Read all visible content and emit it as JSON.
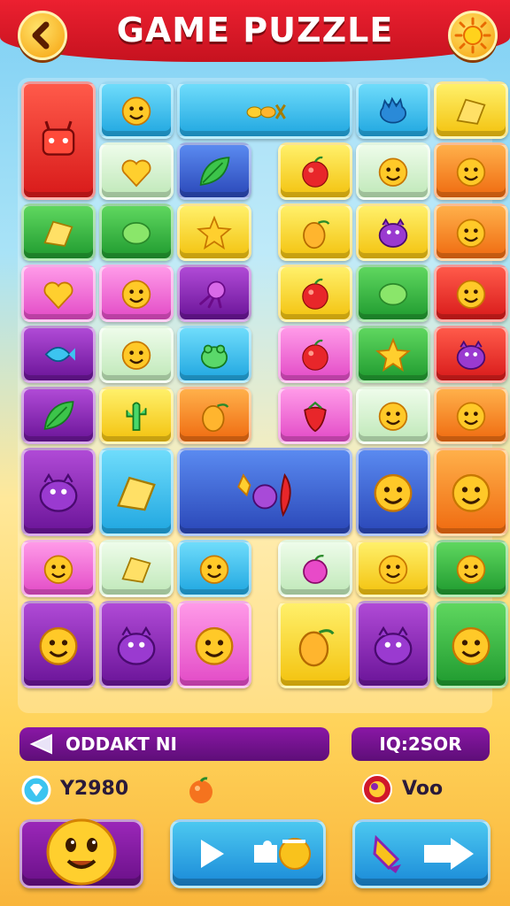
{
  "header": {
    "title": "GAME PUZZLE",
    "back_icon": "chevron-left-icon",
    "settings_icon": "sun-icon"
  },
  "colors": {
    "red": "#e8262a",
    "blue": "#3cc4f0",
    "green": "#2fb34a",
    "yellow": "#f9d51c",
    "orange": "#f5841e",
    "purple": "#8a22b0",
    "pink": "#f26ad6",
    "cream": "#d6f3d0",
    "navy": "#2a57c8"
  },
  "grid": {
    "tiles": [
      {
        "c": 0,
        "r": 0,
        "h": 2,
        "color": "red",
        "icon": "robot-icon"
      },
      {
        "c": 1,
        "r": 0,
        "color": "blue",
        "icon": "smiley-icon"
      },
      {
        "c": 2,
        "r": 0,
        "w": 2.3,
        "color": "blue",
        "icon": "food-icon"
      },
      {
        "c": 4.3,
        "r": 0,
        "color": "blue",
        "icon": "hedgehog-icon"
      },
      {
        "c": 5.3,
        "r": 0,
        "color": "yellow",
        "icon": "cheese-icon"
      },
      {
        "c": 1,
        "r": 1,
        "color": "cream",
        "icon": "heart-icon"
      },
      {
        "c": 2,
        "r": 1,
        "color": "navy",
        "icon": "leaf-icon"
      },
      {
        "c": 3.3,
        "r": 1,
        "color": "yellow",
        "icon": "apple-icon"
      },
      {
        "c": 4.3,
        "r": 1,
        "color": "cream",
        "icon": "smiley-icon"
      },
      {
        "c": 5.3,
        "r": 1,
        "color": "orange",
        "icon": "smiley-icon"
      },
      {
        "c": 0,
        "r": 2,
        "color": "green",
        "icon": "cheese-icon"
      },
      {
        "c": 1,
        "r": 2,
        "color": "green",
        "icon": "lemon-icon"
      },
      {
        "c": 2,
        "r": 2,
        "color": "yellow",
        "icon": "star-icon"
      },
      {
        "c": 3.3,
        "r": 2,
        "color": "yellow",
        "icon": "mango-icon"
      },
      {
        "c": 4.3,
        "r": 2,
        "color": "yellow",
        "icon": "monster-icon"
      },
      {
        "c": 5.3,
        "r": 2,
        "color": "orange",
        "icon": "smiley-icon"
      },
      {
        "c": 0,
        "r": 3,
        "color": "pink",
        "icon": "heart-icon"
      },
      {
        "c": 1,
        "r": 3,
        "color": "pink",
        "icon": "smiley-icon"
      },
      {
        "c": 2,
        "r": 3,
        "color": "purple",
        "icon": "octopus-icon"
      },
      {
        "c": 3.3,
        "r": 3,
        "color": "yellow",
        "icon": "apple-icon"
      },
      {
        "c": 4.3,
        "r": 3,
        "color": "green",
        "icon": "lemon-icon"
      },
      {
        "c": 5.3,
        "r": 3,
        "color": "red",
        "icon": "smiley-icon"
      },
      {
        "c": 0,
        "r": 4,
        "color": "purple",
        "icon": "fish-icon"
      },
      {
        "c": 1,
        "r": 4,
        "color": "cream",
        "icon": "smiley-icon"
      },
      {
        "c": 2,
        "r": 4,
        "color": "blue",
        "icon": "frog-icon"
      },
      {
        "c": 3.3,
        "r": 4,
        "color": "pink",
        "icon": "apple-icon"
      },
      {
        "c": 4.3,
        "r": 4,
        "color": "green",
        "icon": "star-icon"
      },
      {
        "c": 5.3,
        "r": 4,
        "color": "red",
        "icon": "monster-icon"
      },
      {
        "c": 0,
        "r": 5,
        "color": "purple",
        "icon": "leaf-icon"
      },
      {
        "c": 1,
        "r": 5,
        "color": "yellow",
        "icon": "cactus-icon"
      },
      {
        "c": 2,
        "r": 5,
        "color": "orange",
        "icon": "mango-icon"
      },
      {
        "c": 3.3,
        "r": 5,
        "color": "pink",
        "icon": "strawberry-icon"
      },
      {
        "c": 4.3,
        "r": 5,
        "color": "cream",
        "icon": "smiley-icon"
      },
      {
        "c": 5.3,
        "r": 5,
        "color": "orange",
        "icon": "smiley-icon"
      },
      {
        "c": 0,
        "r": 6,
        "h": 1.5,
        "color": "purple",
        "icon": "monster-icon"
      },
      {
        "c": 1,
        "r": 6,
        "h": 1.5,
        "color": "blue",
        "icon": "cheese-icon"
      },
      {
        "c": 2,
        "r": 6,
        "w": 2.3,
        "h": 1.5,
        "color": "navy",
        "icon": "fruit-combo-icon"
      },
      {
        "c": 4.3,
        "r": 6,
        "h": 1.5,
        "color": "navy",
        "icon": "smiley-icon"
      },
      {
        "c": 5.3,
        "r": 6,
        "h": 1.5,
        "color": "orange",
        "icon": "smiley-icon"
      },
      {
        "c": 0,
        "r": 7.5,
        "color": "pink",
        "icon": "smiley-icon"
      },
      {
        "c": 1,
        "r": 7.5,
        "color": "cream",
        "icon": "cheese-icon"
      },
      {
        "c": 2,
        "r": 7.5,
        "color": "blue",
        "icon": "smiley-icon"
      },
      {
        "c": 3.3,
        "r": 7.5,
        "color": "cream",
        "icon": "plum-icon"
      },
      {
        "c": 4.3,
        "r": 7.5,
        "color": "yellow",
        "icon": "smiley-icon"
      },
      {
        "c": 5.3,
        "r": 7.5,
        "color": "green",
        "icon": "smiley-icon"
      },
      {
        "c": 0,
        "r": 8.5,
        "h": 1.5,
        "color": "purple",
        "icon": "smiley-icon"
      },
      {
        "c": 1,
        "r": 8.5,
        "h": 1.5,
        "color": "purple",
        "icon": "monster-icon"
      },
      {
        "c": 2,
        "r": 8.5,
        "h": 1.5,
        "color": "pink",
        "icon": "smiley-icon"
      },
      {
        "c": 3.3,
        "r": 8.5,
        "h": 1.5,
        "color": "yellow",
        "icon": "mango-icon"
      },
      {
        "c": 4.3,
        "r": 8.5,
        "h": 1.5,
        "color": "purple",
        "icon": "monster-icon"
      },
      {
        "c": 5.3,
        "r": 8.5,
        "h": 1.5,
        "color": "green",
        "icon": "smiley-icon"
      }
    ]
  },
  "status": {
    "level_label": "ODDAKT NI",
    "score_label": "IQ:2SOR",
    "gems": "Y2980",
    "lives": "Voo"
  },
  "actions": {
    "avatar_icon": "smiley-face-icon",
    "play_icon": "play-icon",
    "paint_icon": "paint-brush-icon"
  }
}
